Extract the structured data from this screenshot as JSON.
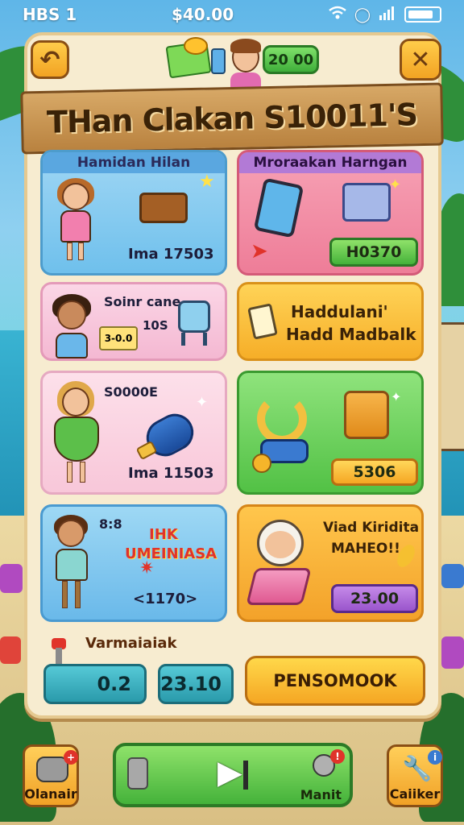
{
  "status_bar": {
    "left": "HBS 1",
    "time": "$40.00"
  },
  "header": {
    "currency": "20 00",
    "title": "THan Clakan S10011'S"
  },
  "cards": [
    {
      "header": "Hamidan Hilan",
      "price": "Ima 17503"
    },
    {
      "header": "Mroraakan Harngan",
      "price": "H0370"
    },
    {
      "title": "Soinr cane",
      "subtitle": "10S",
      "chip": "3-0.0"
    },
    {
      "title_line1": "Haddulani'",
      "title_line2": "Hadd Madbalk"
    },
    {
      "title": "S0000E",
      "price": "Ima 11503"
    },
    {
      "price": "5306"
    },
    {
      "corner": "8:8",
      "promo_line1": "IHK",
      "promo_line2": "UMEINIASA",
      "price": "<1170>"
    },
    {
      "title_line1": "Viad Kiridita",
      "title_line2": "MAHEO!!",
      "price": "23.00"
    }
  ],
  "bottom": {
    "label": "Varmaiaiak",
    "stat1": "0.2",
    "stat2": "23.10",
    "action": "PENSOMOOK"
  },
  "nav": {
    "left": "Olanair",
    "right": "Caiiker",
    "center_label": "Manit"
  },
  "colors": {
    "accent_orange": "#f5a623",
    "accent_green": "#44b23a",
    "accent_teal": "#2a9aab"
  }
}
